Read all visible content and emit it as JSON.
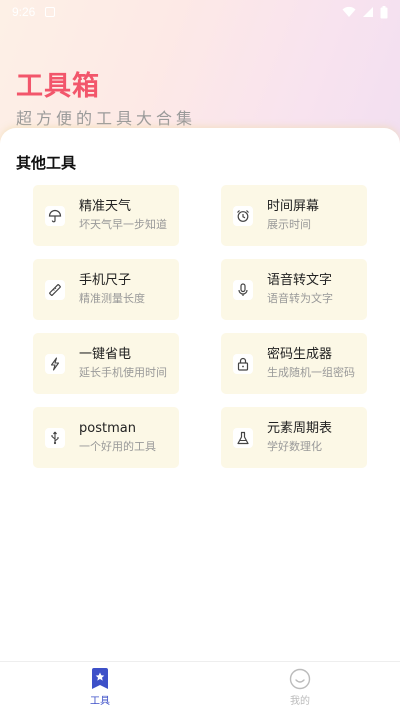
{
  "status_bar": {
    "time": "9:26"
  },
  "header": {
    "title": "工具箱",
    "subtitle": "超方便的工具大合集"
  },
  "section": {
    "title": "其他工具"
  },
  "tools": [
    {
      "name": "精准天气",
      "desc": "坏天气早一步知道",
      "icon": "umbrella-icon"
    },
    {
      "name": "时间屏幕",
      "desc": "展示时间",
      "icon": "alarm-clock-icon"
    },
    {
      "name": "手机尺子",
      "desc": "精准测量长度",
      "icon": "ruler-icon"
    },
    {
      "name": "语音转文字",
      "desc": "语音转为文字",
      "icon": "microphone-icon"
    },
    {
      "name": "一键省电",
      "desc": "延长手机使用时间",
      "icon": "lightning-icon"
    },
    {
      "name": "密码生成器",
      "desc": "生成随机一组密码",
      "icon": "lock-icon"
    },
    {
      "name": "postman",
      "desc": "一个好用的工具",
      "icon": "usb-icon"
    },
    {
      "name": "元素周期表",
      "desc": "学好数理化",
      "icon": "flask-icon"
    }
  ],
  "bottom_nav": {
    "items": [
      {
        "label": "工具",
        "icon": "star-bookmark-icon",
        "active": true
      },
      {
        "label": "我的",
        "icon": "smiley-icon",
        "active": false
      }
    ]
  },
  "colors": {
    "accent": "#f2566b",
    "nav_active": "#3d50c8",
    "nav_inactive": "#cccccc",
    "card_bg": "#fcf8e6"
  }
}
